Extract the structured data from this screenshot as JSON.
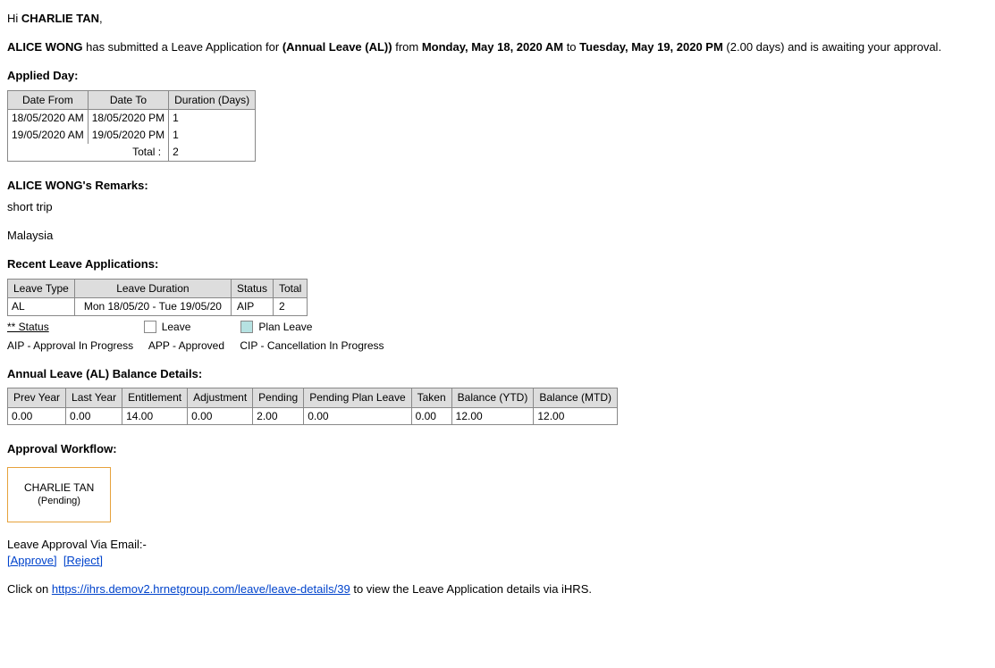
{
  "greeting": {
    "hi": "Hi ",
    "recipient": "CHARLIE TAN",
    "comma": ","
  },
  "intro": {
    "submitter": "ALICE WONG",
    "text1": " has submitted a Leave Application for ",
    "leave_type": "(Annual Leave (AL))",
    "from": " from ",
    "start": "Monday, May 18, 2020 AM",
    "to": " to ",
    "end": "Tuesday, May 19, 2020 PM",
    "days": " (2.00 days) and is awaiting your approval."
  },
  "applied_day": {
    "heading": "Applied Day:",
    "headers": [
      "Date From",
      "Date To",
      "Duration (Days)"
    ],
    "rows": [
      [
        "18/05/2020 AM",
        "18/05/2020 PM",
        "1"
      ],
      [
        "19/05/2020 AM",
        "19/05/2020 PM",
        "1"
      ]
    ],
    "total_label": "Total :",
    "total_value": "2"
  },
  "remarks": {
    "heading": "ALICE WONG's Remarks:",
    "line1": "short trip",
    "line2": "Malaysia"
  },
  "recent": {
    "heading": "Recent Leave Applications:",
    "headers": [
      "Leave Type",
      "Leave Duration",
      "Status",
      "Total"
    ],
    "row": [
      "AL",
      "Mon 18/05/20 - Tue 19/05/20",
      "AIP",
      "2"
    ]
  },
  "status_legend": {
    "label": "** Status",
    "leave": "Leave",
    "plan_leave": "Plan Leave",
    "aip": "AIP - Approval In Progress",
    "app": "APP - Approved",
    "cip": "CIP - Cancellation In Progress"
  },
  "balance": {
    "heading": "Annual Leave (AL) Balance Details:",
    "headers": [
      "Prev Year",
      "Last Year",
      "Entitlement",
      "Adjustment",
      "Pending",
      "Pending Plan Leave",
      "Taken",
      "Balance (YTD)",
      "Balance (MTD)"
    ],
    "row": [
      "0.00",
      "0.00",
      "14.00",
      "0.00",
      "2.00",
      "0.00",
      "0.00",
      "12.00",
      "12.00"
    ]
  },
  "workflow": {
    "heading": "Approval Workflow:",
    "name": "CHARLIE TAN",
    "status": "(Pending)"
  },
  "approval": {
    "heading": "Leave Approval Via Email:-",
    "approve": "[Approve]",
    "reject": "[Reject]"
  },
  "footer": {
    "pre": "Click on ",
    "url": "https://ihrs.demov2.hrnetgroup.com/leave/leave-details/39",
    "post": " to view the Leave Application details via iHRS."
  }
}
